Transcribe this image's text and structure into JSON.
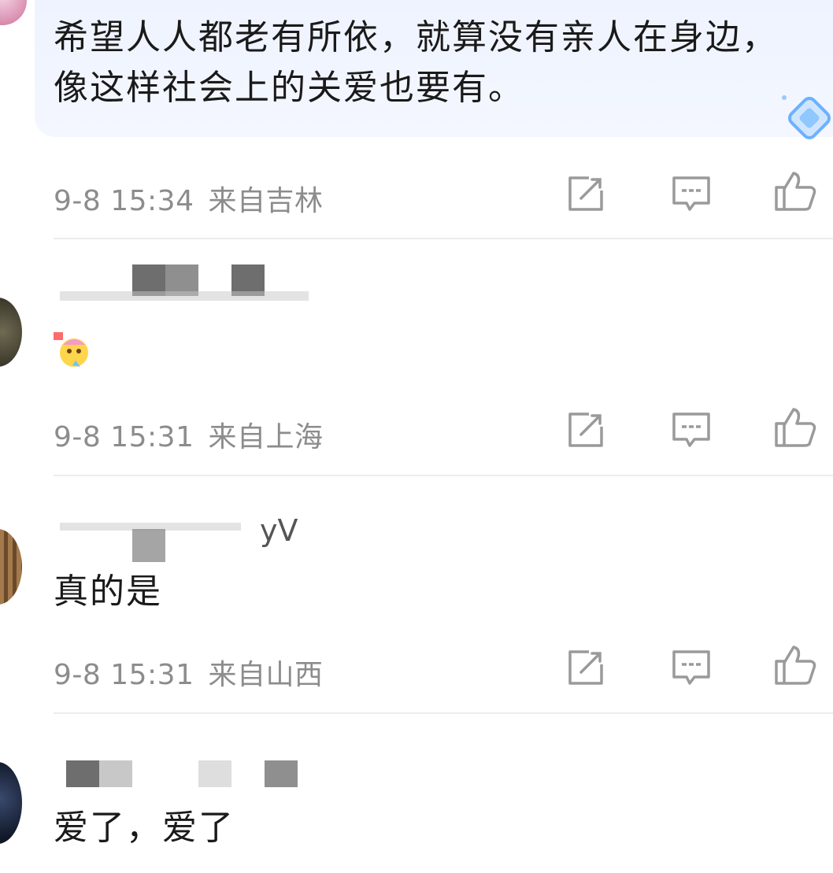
{
  "comments": [
    {
      "text": "希望人人都老有所依，就算没有亲人在身边，像这样社会上的关爱也要有。",
      "time": "9-8 15:34",
      "location": "来自吉林"
    },
    {
      "username_suffix": "...",
      "emoji": "sticker-emoji",
      "time": "9-8 15:31",
      "location": "来自上海"
    },
    {
      "username_suffix": "yV",
      "text": "真的是",
      "time": "9-8 15:31",
      "location": "来自山西"
    },
    {
      "text": "爱了，爱了"
    }
  ],
  "actions": [
    "share-icon",
    "reply-icon",
    "like-icon"
  ],
  "colors": {
    "bubble": "#eef3ff",
    "meta_text": "#8c8c8c",
    "icon": "#9a9a9a",
    "divider": "#ececec"
  }
}
